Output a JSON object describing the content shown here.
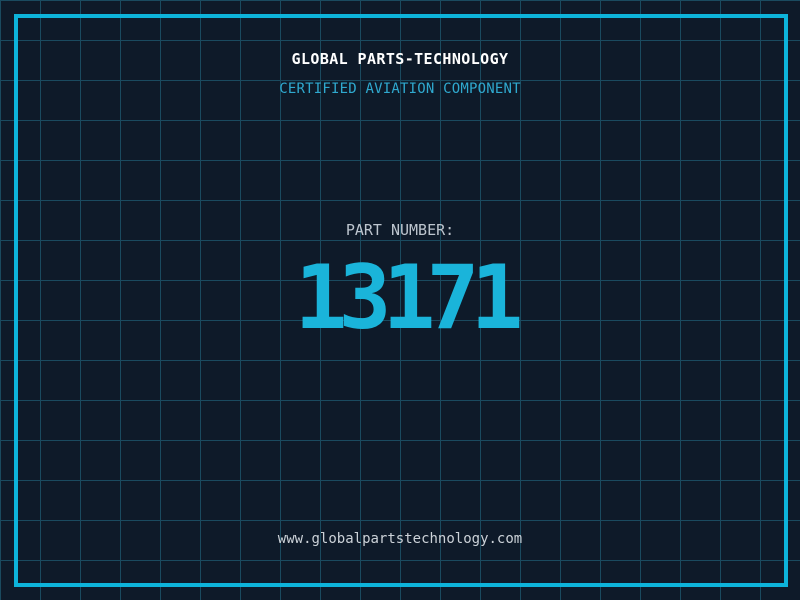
{
  "colors": {
    "background": "#0e1a29",
    "grid_line": "#1a4a5f",
    "frame": "#0db3da",
    "title": "#ffffff",
    "subtitle": "#2fa9cf",
    "label": "#bdc5ce",
    "part_number": "#1ab4da",
    "footer": "#ccd2d8"
  },
  "header": {
    "title": "GLOBAL PARTS-TECHNOLOGY",
    "subtitle": "CERTIFIED AVIATION COMPONENT"
  },
  "part": {
    "label": "PART NUMBER:",
    "value": "13171"
  },
  "footer": {
    "url": "www.globalpartstechnology.com"
  }
}
